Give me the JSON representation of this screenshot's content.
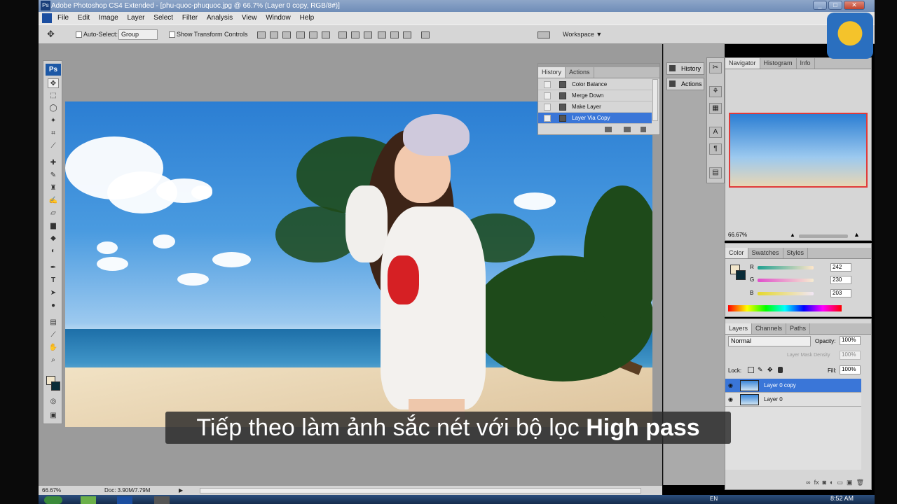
{
  "app": {
    "title": "Adobe Photoshop CS4 Extended - [phu-quoc-phuquoc.jpg @ 66.7% (Layer 0 copy, RGB/8#)]",
    "ps_badge": "Ps"
  },
  "menu": [
    "File",
    "Edit",
    "Image",
    "Layer",
    "Select",
    "Filter",
    "Analysis",
    "View",
    "Window",
    "Help"
  ],
  "options_bar": {
    "auto_select_label": "Auto-Select:",
    "auto_select_value": "Group",
    "show_transform_label": "Show Transform Controls",
    "workspace_label": "Workspace ▼"
  },
  "history_panel": {
    "tabs": [
      "History",
      "Actions"
    ],
    "rows": [
      {
        "label": "Color Balance",
        "selected": false
      },
      {
        "label": "Merge Down",
        "selected": false
      },
      {
        "label": "Make Layer",
        "selected": false
      },
      {
        "label": "Layer Via Copy",
        "selected": true
      }
    ]
  },
  "dock": {
    "history_label": "History",
    "actions_label": "Actions"
  },
  "navigator": {
    "tabs": [
      "Navigator",
      "Histogram",
      "Info"
    ],
    "zoom": "66.67%"
  },
  "color_panel": {
    "tabs": [
      "Color",
      "Swatches",
      "Styles"
    ],
    "r_label": "R",
    "r": "242",
    "g_label": "G",
    "g": "230",
    "b_label": "B",
    "b": "203",
    "foreground": "#f2e6cb"
  },
  "layers_panel": {
    "tabs": [
      "Layers",
      "Channels",
      "Paths"
    ],
    "blend_mode": "Normal",
    "opacity_label": "Opacity:",
    "opacity": "100%",
    "mask_density_label": "Layer Mask Density",
    "mask_density": "100%",
    "lock_label": "Lock:",
    "fill_label": "Fill:",
    "fill": "100%",
    "layers": [
      {
        "name": "Layer 0 copy",
        "active": true
      },
      {
        "name": "Layer 0",
        "active": false
      }
    ]
  },
  "status_bar": {
    "zoom": "66.67%",
    "doc": "Doc: 3.90M/7.79M"
  },
  "taskbar": {
    "lang": "EN",
    "time": "8:52 AM"
  },
  "caption": {
    "text": "Tiếp theo làm ảnh sắc nét với bộ lọc ",
    "bold": "High pass"
  },
  "colors": {
    "accent": "#3a76d8",
    "panel": "#d6d6d6",
    "workarea": "#9b9b9b"
  }
}
